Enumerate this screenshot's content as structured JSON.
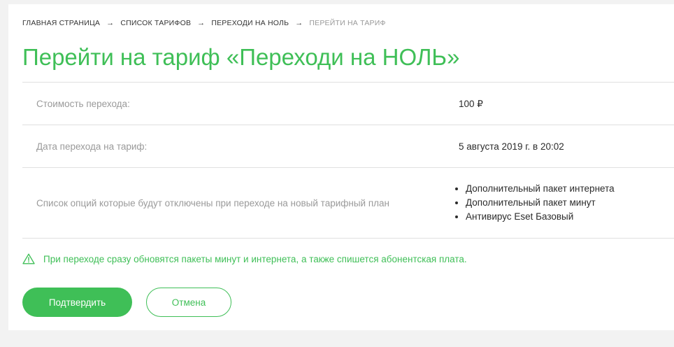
{
  "breadcrumb": {
    "items": [
      {
        "label": "ГЛАВНАЯ СТРАНИЦА"
      },
      {
        "label": "СПИСОК ТАРИФОВ"
      },
      {
        "label": "ПЕРЕХОДИ НА НОЛЬ"
      },
      {
        "label": "ПЕРЕЙТИ НА ТАРИФ"
      }
    ],
    "separator": "→"
  },
  "page": {
    "title": "Перейти на тариф «Переходи на НОЛЬ»"
  },
  "details": {
    "cost": {
      "label": "Стоимость перехода:",
      "value": "100 ₽"
    },
    "date": {
      "label": "Дата перехода на тариф:",
      "value": "5 августа 2019 г. в 20:02"
    },
    "options": {
      "label": "Список опций которые будут отключены при переходе на новый тарифный план",
      "items": [
        "Дополнительный пакет интернета",
        "Дополнительный пакет минут",
        "Антивирус Eset Базовый"
      ]
    }
  },
  "warning": {
    "icon": "warning-triangle-icon",
    "text": "При переходе сразу обновятся пакеты минут и интернета, а также спишется абонентская плата."
  },
  "actions": {
    "confirm_label": "Подтвердить",
    "cancel_label": "Отмена"
  },
  "colors": {
    "accent": "#3fbf57",
    "background": "#f2f2f2",
    "card": "#ffffff",
    "muted_text": "#9a9a9a"
  }
}
